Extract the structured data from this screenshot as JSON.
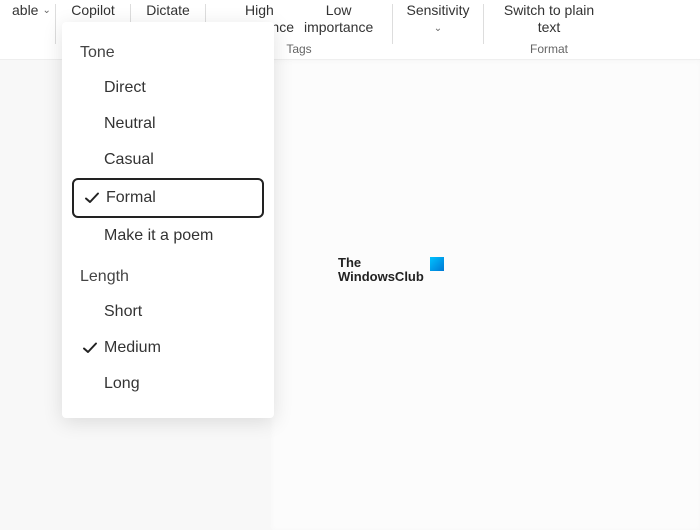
{
  "ribbon": {
    "table": "able",
    "table_chevron": "⌄",
    "copilot": "Copilot",
    "dictate": "Dictate",
    "dictate_chevron": "⌄",
    "high_importance": "High\nimportance",
    "low_importance": "Low\nimportance",
    "sensitivity": "Sensitivity",
    "sensitivity_chevron": "⌄",
    "switch_to_plain": "Switch to plain\ntext",
    "tags_group": "Tags",
    "format_group": "Format"
  },
  "menu": {
    "section_tone": "Tone",
    "tone_items": [
      {
        "label": "Direct",
        "selected": false
      },
      {
        "label": "Neutral",
        "selected": false
      },
      {
        "label": "Casual",
        "selected": false
      },
      {
        "label": "Formal",
        "selected": true,
        "boxed": true
      },
      {
        "label": "Make it a poem",
        "selected": false
      }
    ],
    "section_length": "Length",
    "length_items": [
      {
        "label": "Short",
        "selected": false
      },
      {
        "label": "Medium",
        "selected": true
      },
      {
        "label": "Long",
        "selected": false
      }
    ]
  },
  "watermark": {
    "line1": "The",
    "line2": "WindowsClub"
  }
}
